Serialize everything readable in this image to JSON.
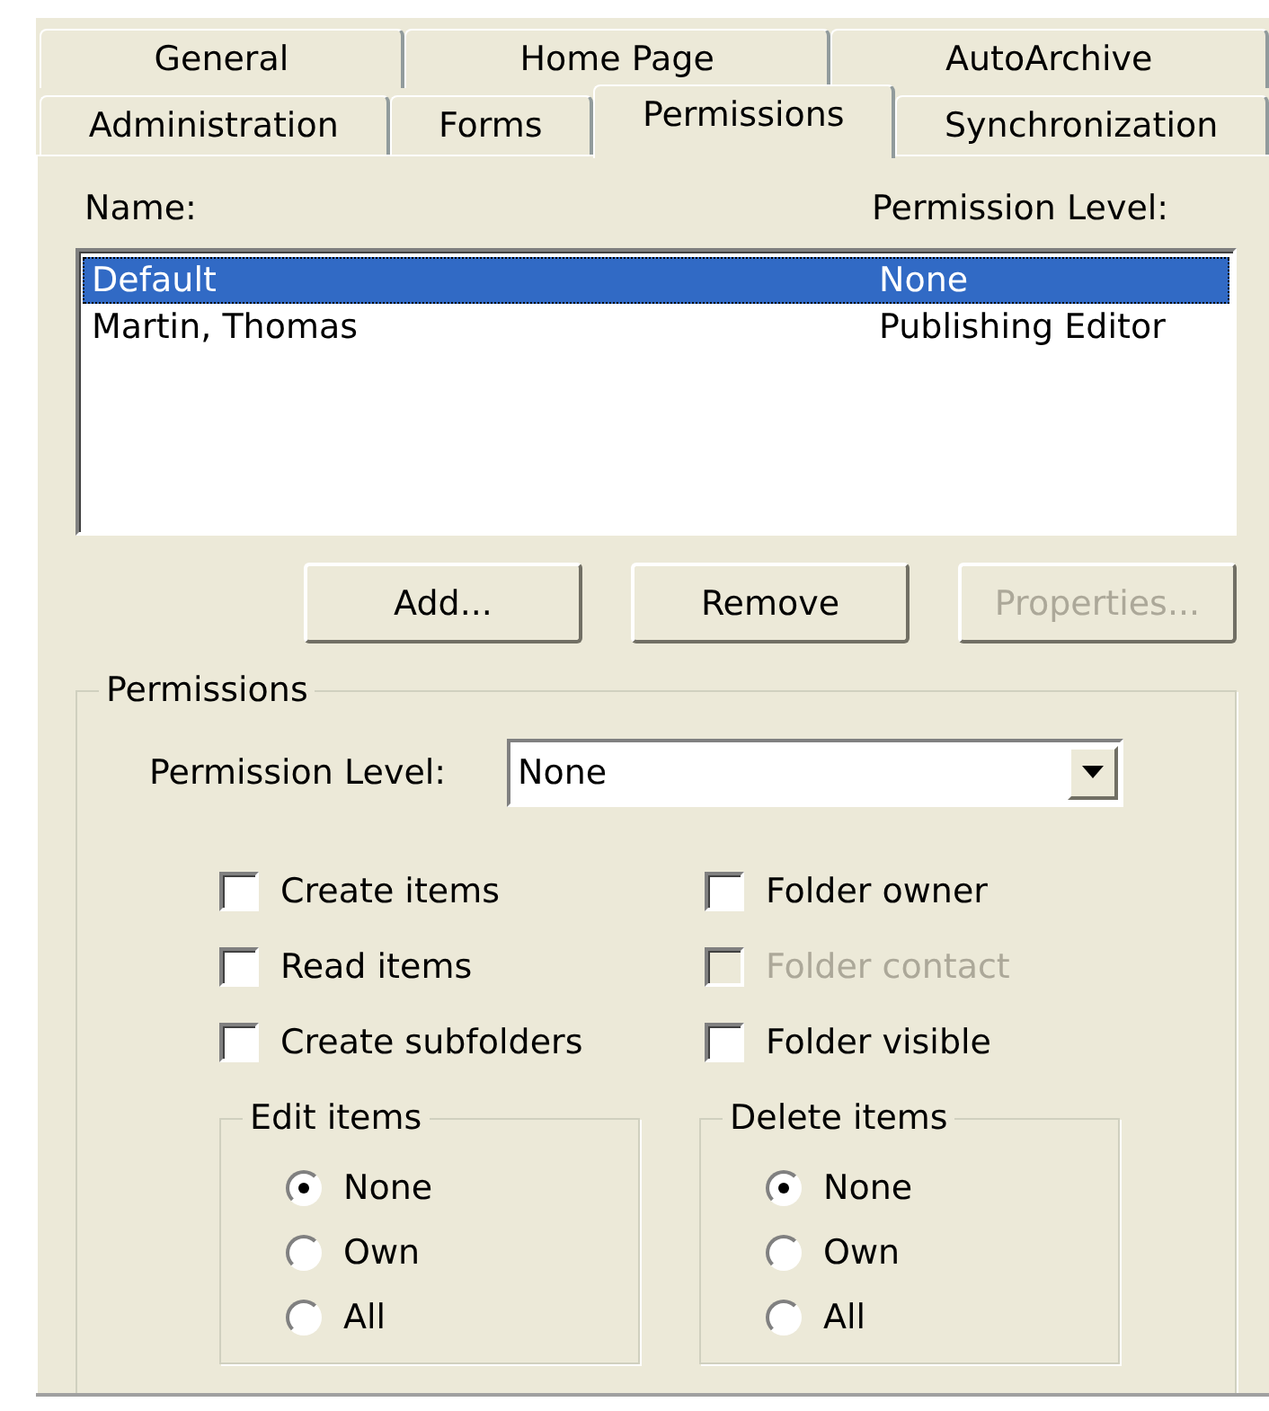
{
  "tabs": [
    [
      {
        "label": "General",
        "selected": false
      },
      {
        "label": "Home Page",
        "selected": false
      },
      {
        "label": "AutoArchive",
        "selected": false
      }
    ],
    [
      {
        "label": "Administration",
        "selected": false
      },
      {
        "label": "Forms",
        "selected": false
      },
      {
        "label": "Permissions",
        "selected": true
      },
      {
        "label": "Synchronization",
        "selected": false
      }
    ]
  ],
  "list": {
    "columns": [
      "Name:",
      "Permission Level:"
    ],
    "rows": [
      {
        "name": "Default",
        "level": "None",
        "selected": true
      },
      {
        "name": "Martin, Thomas",
        "level": "Publishing Editor",
        "selected": false
      }
    ]
  },
  "buttons": [
    {
      "label": "Add...",
      "disabled": false
    },
    {
      "label": "Remove",
      "disabled": false
    },
    {
      "label": "Properties...",
      "disabled": true
    }
  ],
  "permissions": {
    "title": "Permissions",
    "level_label": "Permission Level:",
    "level_value": "None",
    "checkboxes": [
      {
        "label": "Create items",
        "checked": false,
        "disabled": false
      },
      {
        "label": "Folder owner",
        "checked": false,
        "disabled": false
      },
      {
        "label": "Read items",
        "checked": false,
        "disabled": false
      },
      {
        "label": "Folder contact",
        "checked": false,
        "disabled": true
      },
      {
        "label": "Create subfolders",
        "checked": false,
        "disabled": false
      },
      {
        "label": "Folder visible",
        "checked": false,
        "disabled": false
      }
    ],
    "radio_groups": [
      {
        "title": "Edit items",
        "options": [
          {
            "label": "None",
            "selected": true
          },
          {
            "label": "Own",
            "selected": false
          },
          {
            "label": "All",
            "selected": false
          }
        ]
      },
      {
        "title": "Delete items",
        "options": [
          {
            "label": "None",
            "selected": true
          },
          {
            "label": "Own",
            "selected": false
          },
          {
            "label": "All",
            "selected": false
          }
        ]
      }
    ]
  }
}
